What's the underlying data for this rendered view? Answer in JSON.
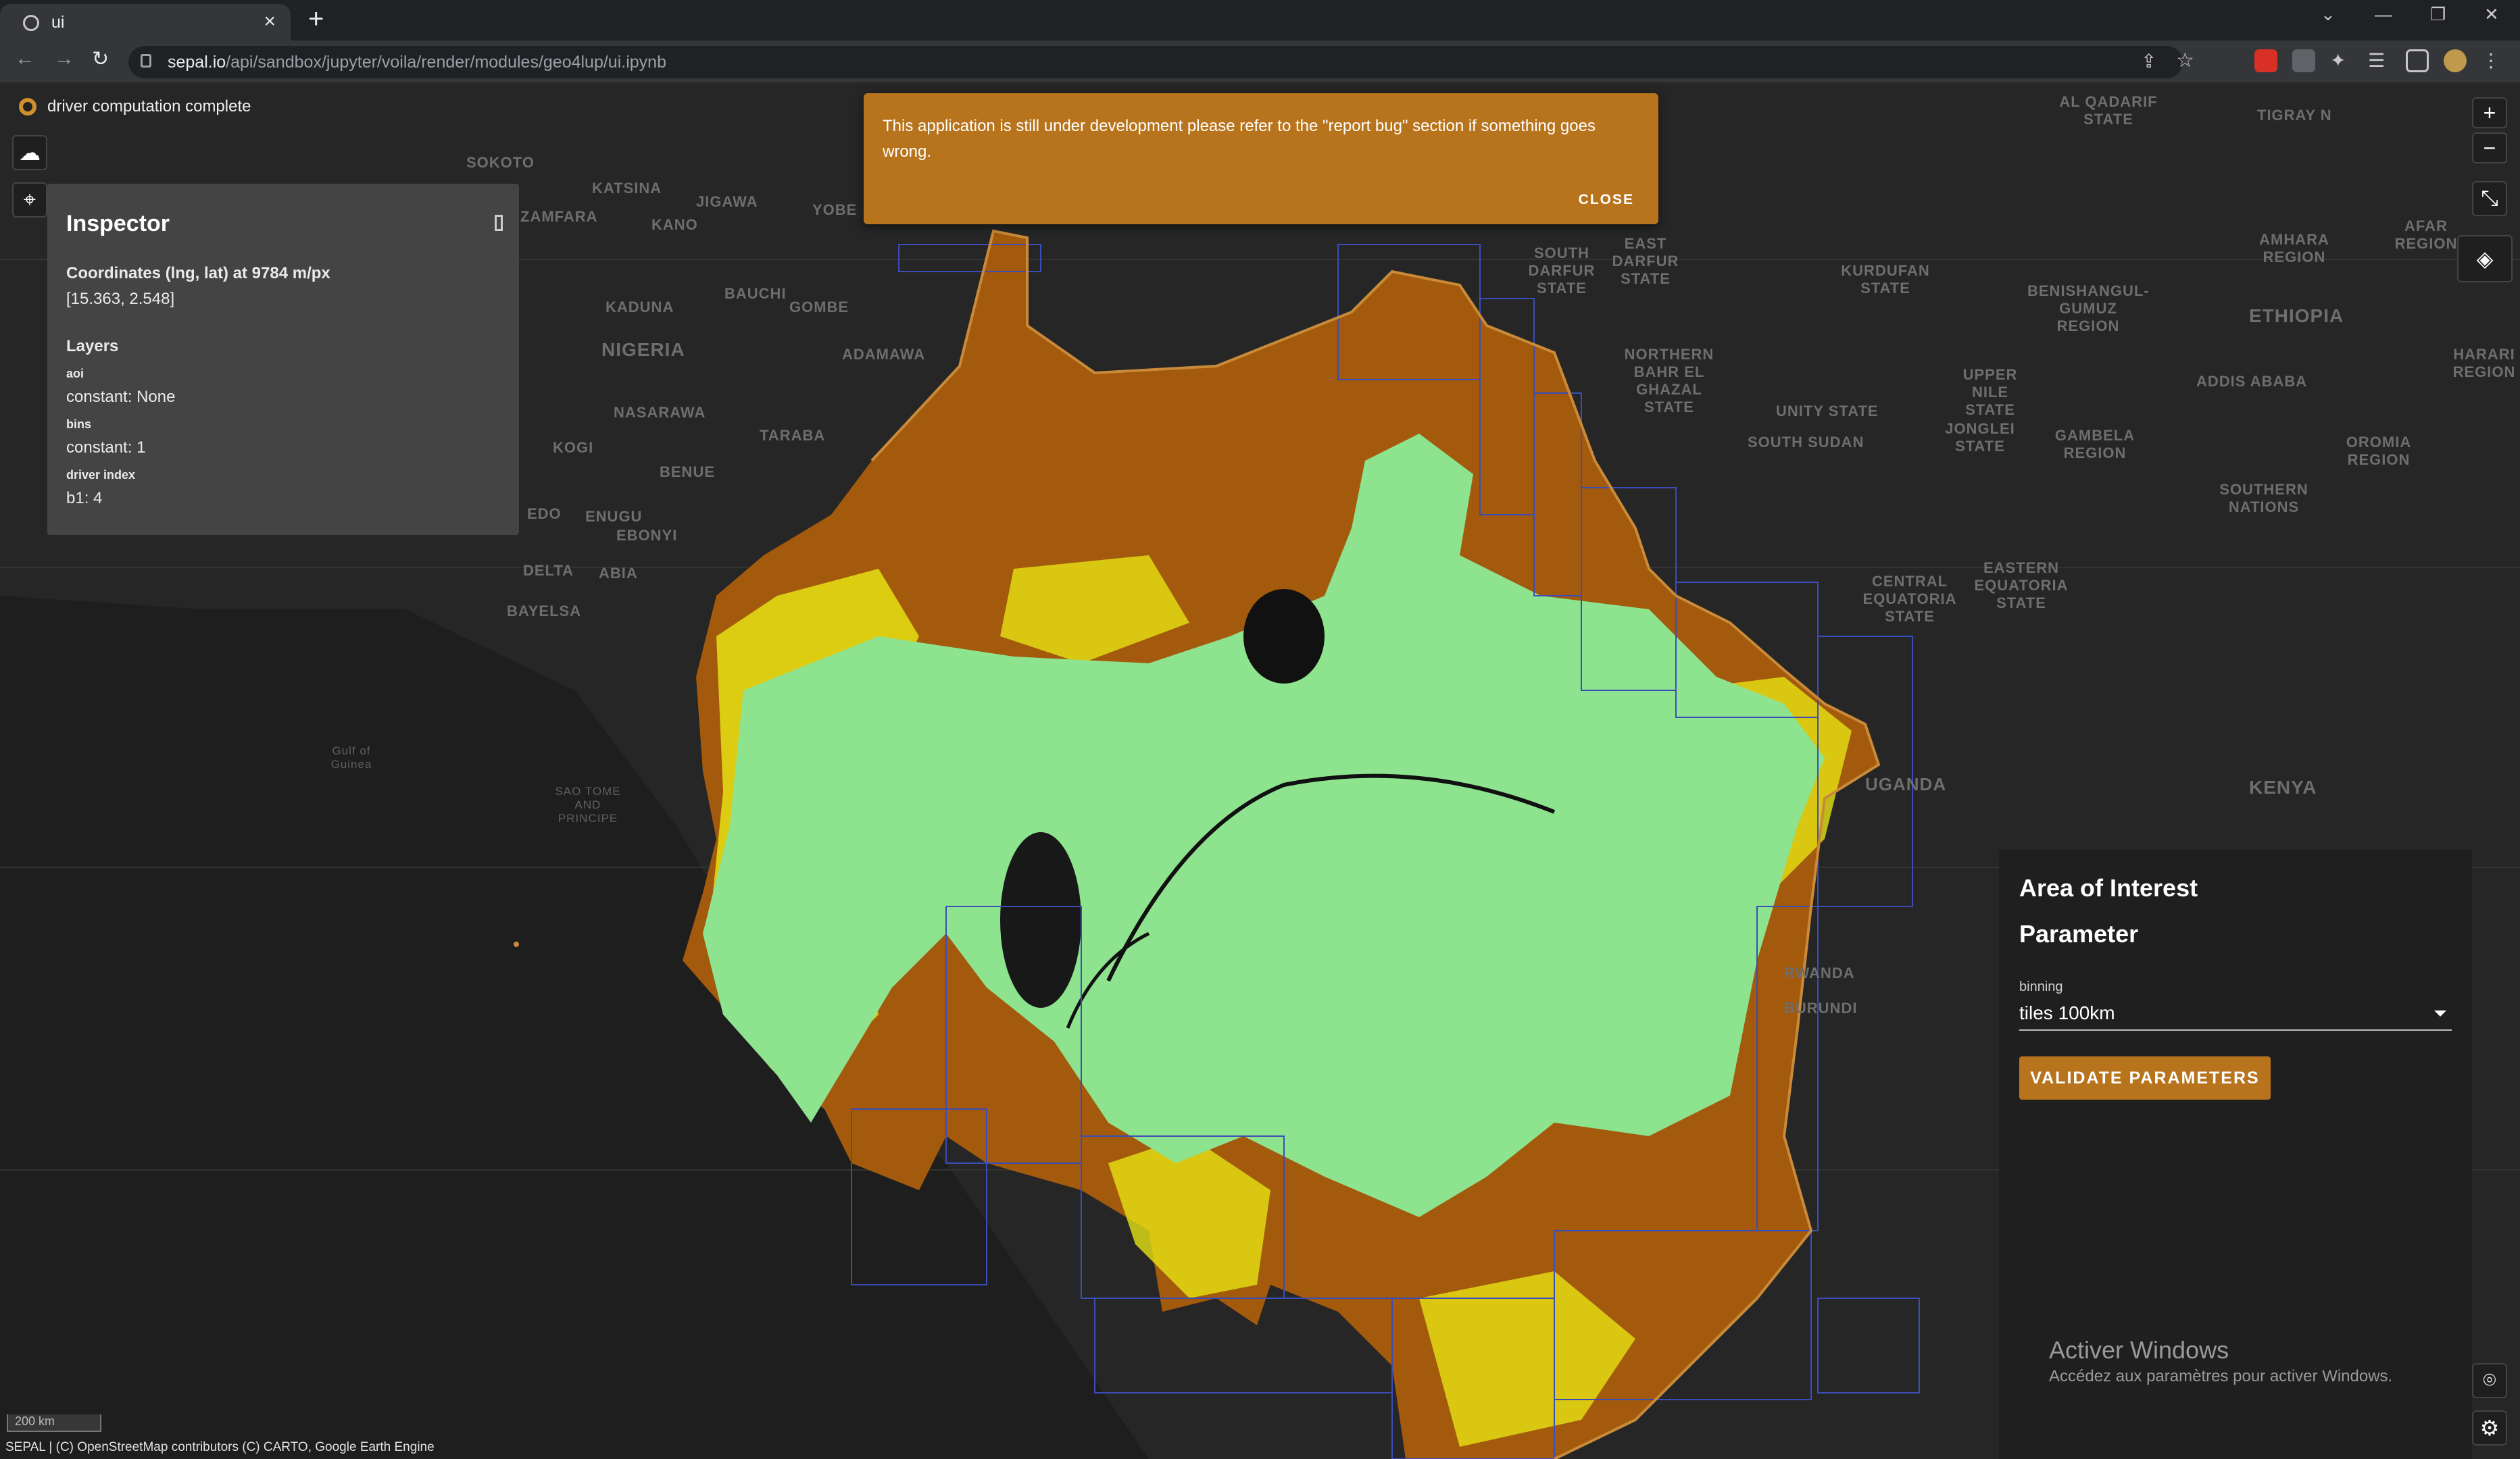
{
  "browser": {
    "tab_title": "ui",
    "url_host": "sepal.io",
    "url_path": "/api/sandbox/jupyter/voila/render/modules/geo4lup/ui.ipynb"
  },
  "status": {
    "text": "driver computation complete",
    "color": "#d2902c"
  },
  "inspector": {
    "title": "Inspector",
    "coords_heading": "Coordinates (lng, lat) at 9784 m/px",
    "coords_value": "[15.363, 2.548]",
    "layers_heading": "Layers",
    "layers": [
      {
        "name": "aoi",
        "value": "constant: None"
      },
      {
        "name": "bins",
        "value": "constant: 1"
      },
      {
        "name": "driver index",
        "value": "b1: 4"
      }
    ]
  },
  "banner": {
    "message": "This application is still under development please refer to the \"report bug\" section if something goes wrong.",
    "close_label": "CLOSE",
    "color": "#b8741d"
  },
  "panel": {
    "aoi_title": "Area of Interest",
    "parameter_title": "Parameter",
    "binning_label": "binning",
    "binning_value": "tiles 100km",
    "validate_label": "VALIDATE PARAMETERS"
  },
  "watermark": {
    "title": "Activer Windows",
    "subtitle": "Accédez aux paramètres pour activer Windows."
  },
  "map": {
    "scale_label": "200 km",
    "attribution": "SEPAL | (C) OpenStreetMap contributors (C) CARTO, Google Earth Engine",
    "colors": {
      "background": "#1e1e1e",
      "forest": "#8ee38f",
      "degraded": "#e6e214",
      "deforested": "#a35a0c",
      "grid": "#3b4db8",
      "boundary": "#c98b3a"
    },
    "place_labels": [
      "SOKOTO",
      "KATSINA",
      "ZAMFARA",
      "JIGAWA",
      "KANO",
      "YOBE",
      "BAUCHI",
      "KADUNA",
      "GOMBE",
      "NIGERIA",
      "ADAMAWA",
      "NASARAWA",
      "TARABA",
      "KOGI",
      "BENUE",
      "ENUGU",
      "EBONYI",
      "EDO",
      "DELTA",
      "ABIA",
      "BAYELSA",
      "Gulf of Guinea",
      "SAO TOME AND PRINCIPE",
      "AL QADARIF STATE",
      "TIGRAY N",
      "AMHARA REGION",
      "AFAR REGION",
      "ETHIOPIA",
      "ADDIS ABABA",
      "HARARI REGION",
      "OROMIA REGION",
      "SOUTHERN NATIONS",
      "BENISHANGUL-GUMUZ REGION",
      "UPPER NILE STATE",
      "JONGLEI STATE",
      "GAMBELA REGION",
      "SOUTH SUDAN",
      "UNITY STATE",
      "NORTHERN BAHR EL GHAZAL STATE",
      "SOUTH DARFUR STATE",
      "EAST DARFUR STATE",
      "KURDUFAN STATE",
      "CENTRAL EQUATORIA STATE",
      "EASTERN EQUATORIA STATE",
      "KENYA",
      "UGANDA",
      "RWANDA",
      "BURUNDI"
    ]
  }
}
